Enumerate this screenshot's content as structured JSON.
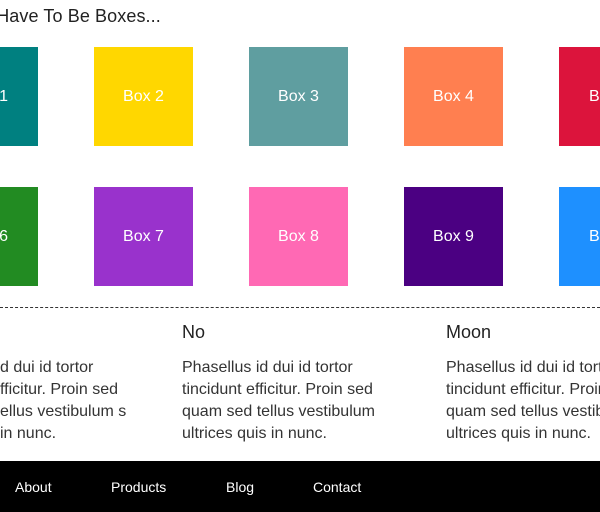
{
  "heading": "t Have To Be Boxes...",
  "boxes": [
    {
      "label": "1",
      "color": "#008080"
    },
    {
      "label": "Box 2",
      "color": "#FFD700"
    },
    {
      "label": "Box 3",
      "color": "#5F9EA0"
    },
    {
      "label": "Box 4",
      "color": "#FF7F50"
    },
    {
      "label": "Bo",
      "color": "#DC143C"
    },
    {
      "label": "6",
      "color": "#228B22"
    },
    {
      "label": "Box 7",
      "color": "#9932CC"
    },
    {
      "label": "Box 8",
      "color": "#FF69B4"
    },
    {
      "label": "Box 9",
      "color": "#4B0082"
    },
    {
      "label": "Bo",
      "color": "#1E90FF"
    }
  ],
  "columns": [
    {
      "title": "",
      "text": "d dui id tortor fficitur. Proin sed ellus vestibulum s in nunc."
    },
    {
      "title": "No",
      "text": "Phasellus id dui id tortor tincidunt efficitur. Proin sed quam sed tellus vestibulum ultrices quis in nunc."
    },
    {
      "title": "Moon",
      "text": "Phasellus id dui id tortor tincidunt efficitur. Proin sed quam sed tellus vestibulum ultrices quis in nunc."
    }
  ],
  "nav": {
    "about": "About",
    "products": "Products",
    "blog": "Blog",
    "contact": "Contact"
  }
}
